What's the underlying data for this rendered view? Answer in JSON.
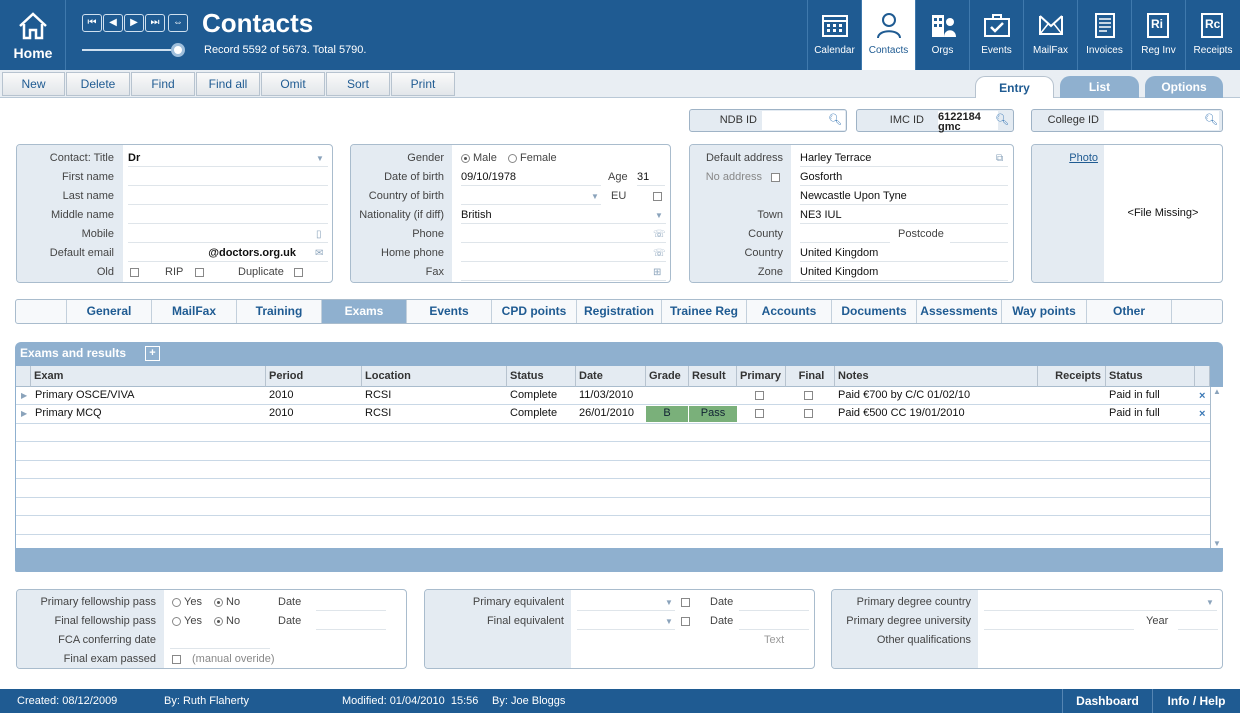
{
  "header": {
    "home_label": "Home",
    "title": "Contacts",
    "record_text": "Record 5592 of 5673. Total 5790.",
    "nav_buttons": [
      "⏮",
      "◀",
      "▶",
      "⏭",
      "⇔"
    ],
    "modules": [
      {
        "label": "Calendar",
        "icon": "calendar-icon"
      },
      {
        "label": "Contacts",
        "icon": "person-icon"
      },
      {
        "label": "Orgs",
        "icon": "buildings-icon"
      },
      {
        "label": "Events",
        "icon": "briefcase-check-icon"
      },
      {
        "label": "MailFax",
        "icon": "mail-icon"
      },
      {
        "label": "Invoices",
        "icon": "invoice-icon"
      },
      {
        "label": "Reg Inv",
        "icon": "reg-invoice-icon"
      },
      {
        "label": "Receipts",
        "icon": "receipt-icon"
      }
    ]
  },
  "toolbar": {
    "buttons": [
      "New",
      "Delete",
      "Find",
      "Find all",
      "Omit",
      "Sort",
      "Print"
    ]
  },
  "view_tabs": [
    {
      "label": "Entry",
      "active": true
    },
    {
      "label": "List",
      "active": false
    },
    {
      "label": "Options",
      "active": false
    }
  ],
  "ids": {
    "ndb_label": "NDB ID",
    "ndb_value": "",
    "imc_label": "IMC ID",
    "imc_value": "6122184 gmc",
    "college_label": "College ID",
    "college_value": ""
  },
  "contact": {
    "title_label": "Contact: Title",
    "title_value": "Dr",
    "first_label": "First name",
    "first_value": "",
    "last_label": "Last name",
    "last_value": "",
    "middle_label": "Middle name",
    "middle_value": "",
    "mobile_label": "Mobile",
    "mobile_value": "",
    "email_label": "Default email",
    "email_value": "@doctors.org.uk",
    "old_label": "Old",
    "rip_label": "RIP",
    "duplicate_label": "Duplicate"
  },
  "personal": {
    "gender_label": "Gender",
    "male": "Male",
    "female": "Female",
    "gender_selected": "Male",
    "dob_label": "Date of birth",
    "dob_value": "09/10/1978",
    "age_label": "Age",
    "age_value": "31",
    "cob_label": "Country of birth",
    "cob_value": "",
    "eu_label": "EU",
    "nat_label": "Nationality (if diff)",
    "nat_value": "British",
    "phone_label": "Phone",
    "phone_value": "",
    "home_label": "Home phone",
    "home_value": "",
    "fax_label": "Fax",
    "fax_value": ""
  },
  "address": {
    "default_label": "Default address",
    "line1": "Harley Terrace",
    "noaddr_label": "No address",
    "line2": "Gosforth",
    "line3": "Newcastle Upon Tyne",
    "town_label": "Town",
    "town_value": "NE3 IUL",
    "county_label": "County",
    "county_value": "",
    "postcode_label": "Postcode",
    "postcode_value": "",
    "country_label": "Country",
    "country_value": "United Kingdom",
    "zone_label": "Zone",
    "zone_value": "United Kingdom"
  },
  "photo": {
    "link": "Photo",
    "missing": "<File Missing>"
  },
  "subtabs": [
    {
      "label": "",
      "active": false
    },
    {
      "label": "General",
      "active": false
    },
    {
      "label": "MailFax",
      "active": false
    },
    {
      "label": "Training",
      "active": false
    },
    {
      "label": "Exams",
      "active": true
    },
    {
      "label": "Events",
      "active": false
    },
    {
      "label": "CPD points",
      "active": false
    },
    {
      "label": "Registration",
      "active": false
    },
    {
      "label": "Trainee Reg",
      "active": false
    },
    {
      "label": "Accounts",
      "active": false
    },
    {
      "label": "Documents",
      "active": false
    },
    {
      "label": "Assessments",
      "active": false
    },
    {
      "label": "Way points",
      "active": false
    },
    {
      "label": "Other",
      "active": false
    },
    {
      "label": "",
      "active": false
    }
  ],
  "exams": {
    "title": "Exams and results",
    "add": "+",
    "columns": [
      "Exam",
      "Period",
      "Location",
      "Status",
      "Date",
      "Grade",
      "Result",
      "Primary",
      "Final",
      "Notes",
      "Receipts",
      "Status"
    ],
    "rows": [
      {
        "exam": "Primary OSCE/VIVA",
        "period": "2010",
        "location": "RCSI",
        "status": "Complete",
        "date": "11/03/2010",
        "grade": "",
        "result": "",
        "notes": "Paid €700 by C/C 01/02/10",
        "receipts": "",
        "pay_status": "Paid in full"
      },
      {
        "exam": "Primary MCQ",
        "period": "2010",
        "location": "RCSI",
        "status": "Complete",
        "date": "26/01/2010",
        "grade": "B",
        "result": "Pass",
        "notes": "Paid €500 CC 19/01/2010",
        "receipts": "",
        "pay_status": "Paid in full"
      }
    ],
    "grade_color": "#7ab07a"
  },
  "fellowship": {
    "primary_label": "Primary fellowship pass",
    "final_label": "Final fellowship pass",
    "yes": "Yes",
    "no": "No",
    "date_label": "Date",
    "fca_label": "FCA conferring date",
    "final_exam_label": "Final exam passed",
    "manual": "(manual overide)"
  },
  "equivalent": {
    "primary_label": "Primary equivalent",
    "final_label": "Final equivalent",
    "date_label": "Date",
    "text_label": "Text"
  },
  "degree": {
    "country_label": "Primary degree country",
    "university_label": "Primary degree university",
    "year_label": "Year",
    "other_label": "Other qualifications"
  },
  "footer": {
    "created": "Created: 08/12/2009",
    "created_by": "By: Ruth Flaherty",
    "modified": "Modified: 01/04/2010  15:56",
    "modified_by": "By: Joe Bloggs",
    "dashboard": "Dashboard",
    "info": "Info / Help"
  },
  "colors": {
    "brand": "#1f5b92",
    "panel_label_bg": "#e4ebf2",
    "tab_bg": "#8fb0cf"
  }
}
